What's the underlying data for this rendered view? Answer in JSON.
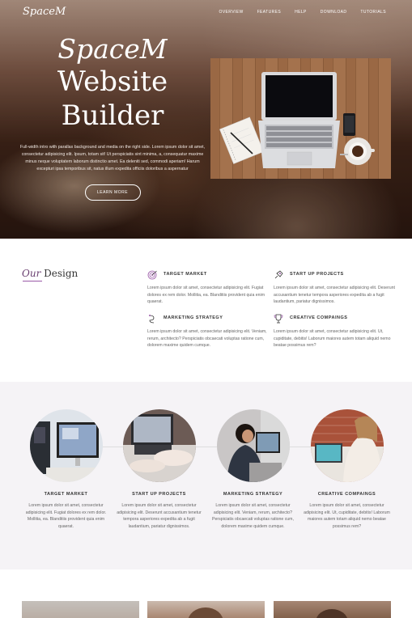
{
  "nav": {
    "logo": "SpaceM",
    "items": [
      "OVERVIEW",
      "FEATURES",
      "HELP",
      "DOWNLOAD",
      "TUTORIALS"
    ]
  },
  "hero": {
    "title_line1": "SpaceM",
    "title_line2": "Website",
    "title_line3": "Builder",
    "description": "Full-width intro with parallax background and media on the right side. Lorem ipsum dolor sit amet, consectetur adipisicing elit. Ipsum, totam sit! Ut perspiciatis sint minima, a, consequatur maxime minus neque voluptatem laborum distinctio amet. Ea deleniti sed, commodi aperiam! Harum excepturi ipsa temporibus sit, natus illum expedita officiis doloribus a aspernatur",
    "button": "LEARN MORE"
  },
  "design": {
    "title_em": "Our",
    "title_rest": "Design",
    "features": [
      {
        "title": "TARGET MARKET",
        "icon": "target-icon",
        "text": "Lorem ipsum dolor sit amet, consectetur adipisicing elit. Fugiat dolores ex rem dolor. Mollitia, ea. Blanditiis provident quia enim quaerat."
      },
      {
        "title": "START UP PROJECTS",
        "icon": "rocket-icon",
        "text": "Lorem ipsum dolor sit amet, consectetur adipisicing elit. Deserunt accusantium tenetur tempora asperiores expedita ab a fugit laudantium, pariatur dignissimos."
      },
      {
        "title": "MARKETING STRATEGY",
        "icon": "strategy-icon",
        "text": "Lorem ipsum dolor sit amet, consectetur adipisicing elit. Veniam, rerum, architecto? Perspiciatis obcaecati voluptas ratione cum, dolorem maxime quidem cumque."
      },
      {
        "title": "CREATIVE COMPAINGS",
        "icon": "trophy-icon",
        "text": "Lorem ipsum dolor sit amet, consectetur adipisicing elit. Ut, cupiditate, debitis! Laborum maiores autem totam aliquid nemo beatae possimus rem?"
      }
    ]
  },
  "team": {
    "cards": [
      {
        "title": "TARGET MARKET",
        "text": "Lorem ipsum dolor sit amet, consectetur adipisicing elit. Fugiat dolores ex rem dolor. Mollitia, ea. Blanditiis provident quia enim quaerat."
      },
      {
        "title": "START UP PROJECTS",
        "text": "Lorem ipsum dolor sit amet, consectetur adipisicing elit. Deserunt accusantium tenetur tempora asperiores expedita ab a fugit laudantium, pariatur dignissimos."
      },
      {
        "title": "MARKETING STRATEGY",
        "text": "Lorem ipsum dolor sit amet, consectetur adipisicing elit. Veniam, rerum, architecto? Perspiciatis obcaecati voluptas ratione cum, dolorem maxime quidem cumque."
      },
      {
        "title": "CREATIVE COMPAINGS",
        "text": "Lorem ipsum dolor sit amet, consectetur adipisicing elit. Ut, cupiditate, debitis! Laborum maiores autem totam aliquid nemo beatae possimus rem?"
      }
    ]
  },
  "colors": {
    "accent": "#9a5aa7",
    "title_em": "#6a3f70",
    "section_bg": "#f5f3f6"
  }
}
